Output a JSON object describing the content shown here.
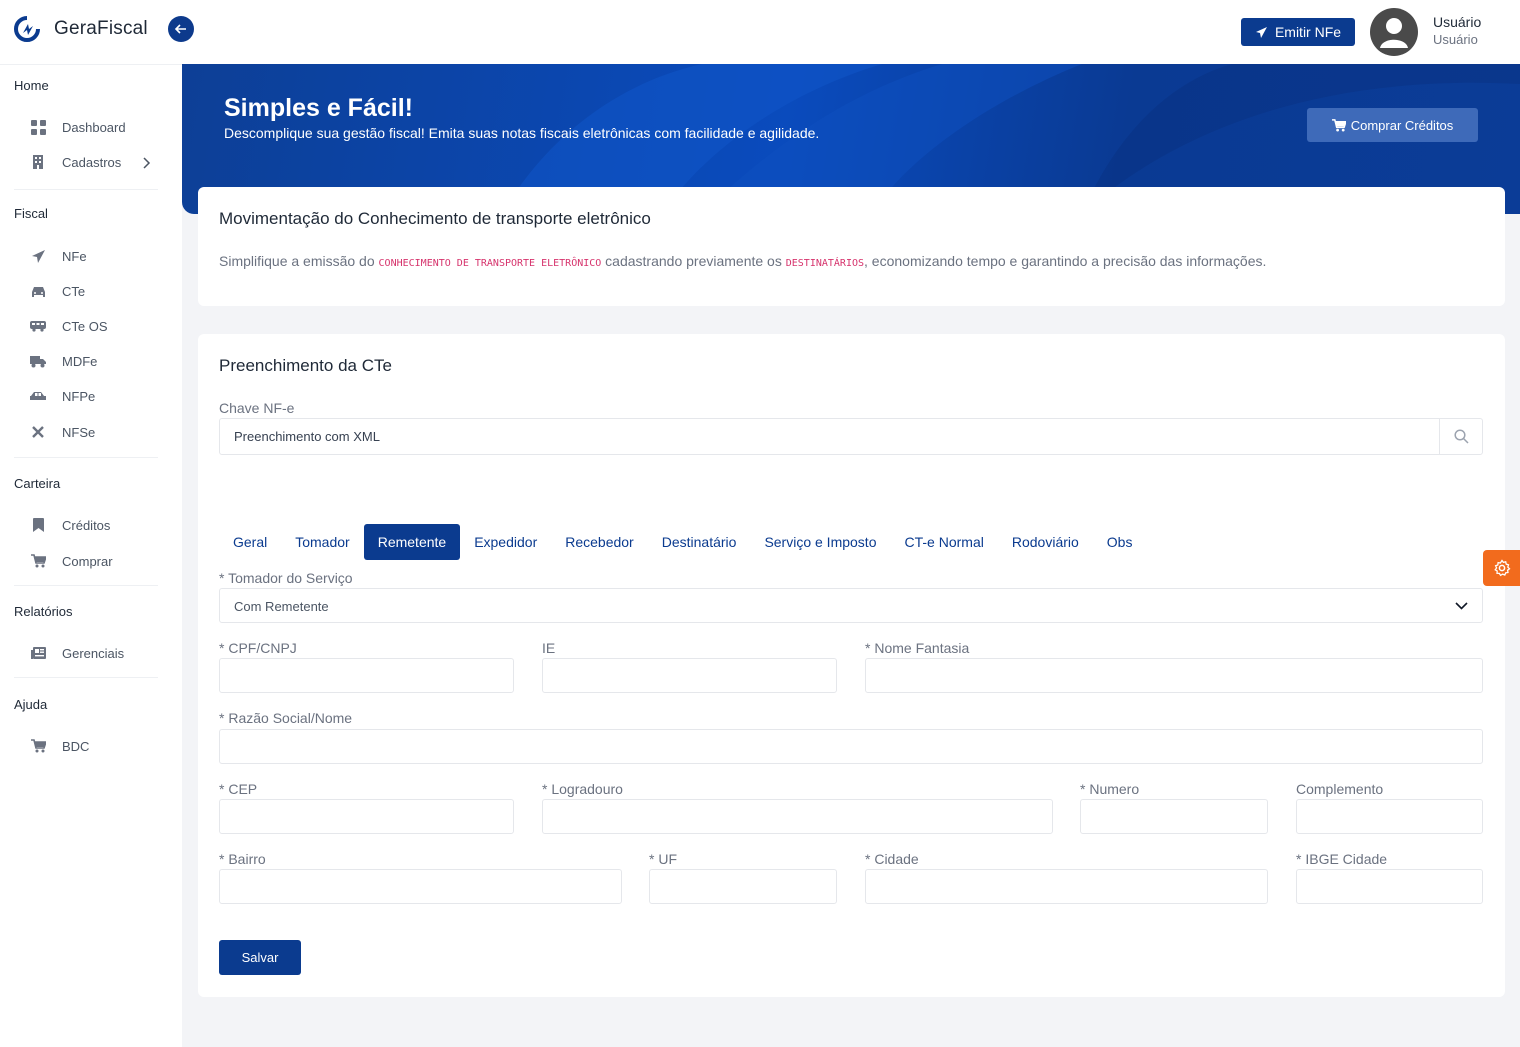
{
  "app": {
    "name": "GeraFiscal"
  },
  "header": {
    "emit_label": "Emitir NFe",
    "user_name": "Usuário",
    "user_role": "Usuário"
  },
  "sidebar": {
    "sections": [
      {
        "title": "Home",
        "items": [
          {
            "label": "Dashboard",
            "icon": "dashboard-icon"
          },
          {
            "label": "Cadastros",
            "icon": "building-icon"
          }
        ]
      },
      {
        "title": "Fiscal",
        "items": [
          {
            "label": "NFe",
            "icon": "send-icon"
          },
          {
            "label": "CTe",
            "icon": "car-icon"
          },
          {
            "label": "CTe OS",
            "icon": "bus-icon"
          },
          {
            "label": "MDFe",
            "icon": "truck-icon"
          },
          {
            "label": "NFPe",
            "icon": "car-side-icon"
          },
          {
            "label": "NFSe",
            "icon": "tools-icon"
          }
        ]
      },
      {
        "title": "Carteira",
        "items": [
          {
            "label": "Créditos",
            "icon": "bookmark-icon"
          },
          {
            "label": "Comprar",
            "icon": "cart-icon"
          }
        ]
      },
      {
        "title": "Relatórios",
        "items": [
          {
            "label": "Gerenciais",
            "icon": "newspaper-icon"
          }
        ]
      },
      {
        "title": "Ajuda",
        "items": [
          {
            "label": "BDC",
            "icon": "cart-icon"
          }
        ]
      }
    ]
  },
  "hero": {
    "title": "Simples e Fácil!",
    "subtitle": "Descomplique sua gestão fiscal! Emita suas notas fiscais eletrônicas com facilidade e agilidade.",
    "buy_label": "Comprar Créditos"
  },
  "intro": {
    "title": "Movimentação do Conhecimento de transporte eletrônico",
    "text_1": "Simplifique a emissão do ",
    "code_1": "CONHECIMENTO DE TRANSPORTE ELETRÔNICO",
    "text_2": " cadastrando previamente os ",
    "code_2": "DESTINATÁRIOS",
    "text_3": ", economizando tempo e garantindo a precisão das informações."
  },
  "form": {
    "title": "Preenchimento da CTe",
    "chave_label": "Chave NF-e",
    "chave_value": "Preenchimento com XML",
    "tabs": [
      "Geral",
      "Tomador",
      "Remetente",
      "Expedidor",
      "Recebedor",
      "Destinatário",
      "Serviço e Imposto",
      "CT-e Normal",
      "Rodoviário",
      "Obs"
    ],
    "active_tab": "Remetente",
    "tomador_label": "* Tomador do Serviço",
    "tomador_value": "Com Remetente",
    "fields": {
      "cpf": "* CPF/CNPJ",
      "ie": "IE",
      "fantasia": "* Nome Fantasia",
      "razao": "* Razão Social/Nome",
      "cep": "* CEP",
      "logradouro": "* Logradouro",
      "numero": "* Numero",
      "complemento": "Complemento",
      "bairro": "* Bairro",
      "uf": "* UF",
      "cidade": "* Cidade",
      "ibge": "* IBGE Cidade"
    },
    "save_label": "Salvar"
  }
}
